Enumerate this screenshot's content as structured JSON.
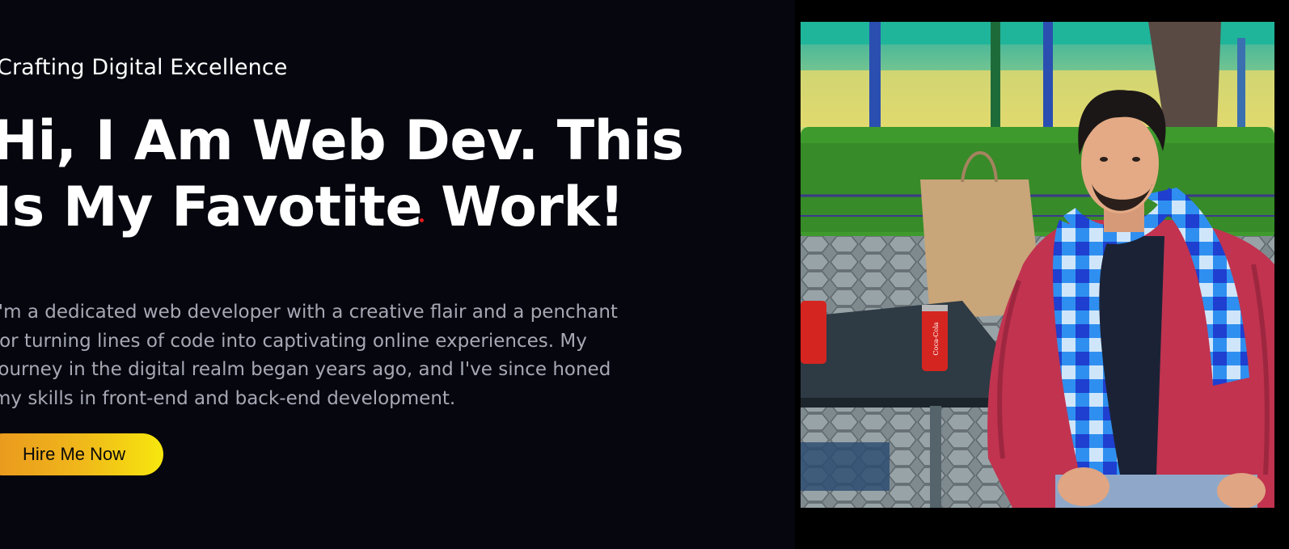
{
  "hero": {
    "tagline": "Crafting Digital Excellence",
    "headline_line1": "Hi, I Am Web Dev. This",
    "headline_line2": "Is My Favotite Work!",
    "bio_lines": [
      "I'm a dedicated web developer with a creative flair and a penchant",
      "for turning lines of code into captivating online experiences. My",
      "journey in the digital realm began years ago, and I've since honed",
      "my skills in front-end and back-end development."
    ],
    "cta_label": "Hire Me Now"
  },
  "portrait": {
    "alt": "Portrait photo of a man in a blue checked scarf seated at an outdoor table",
    "can_label": "Coca-Cola"
  },
  "colors": {
    "background": "#05060e",
    "cta_gradient_start": "#e9941f",
    "cta_gradient_end": "#f7e70e"
  }
}
